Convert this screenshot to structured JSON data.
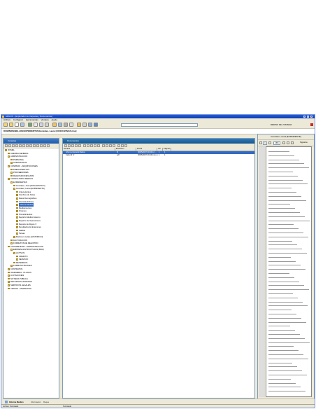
{
  "window": {
    "title": "ARGOS - [Explorador de Carpetas y Documentos]",
    "menu": [
      "Archivo",
      "Configurar",
      "Herramientas",
      "Ventana",
      "Ayuda"
    ]
  },
  "toolbar": {
    "search_value": "",
    "right_label": "MEDINO DEL SISTEMA"
  },
  "pathbar": {
    "text": "DOMINIOS/BELLOS/EXPEDIENTES/Gonzalez, Laura [4001016/05/Informe]"
  },
  "left_panel": {
    "title": "Carpetas",
    "tree": [
      {
        "level": 0,
        "label": "ROMEL"
      },
      {
        "level": 1,
        "label": "AGENDA GENERAL"
      },
      {
        "level": 1,
        "label": "ADMINISTRACION"
      },
      {
        "level": 2,
        "label": "PERSONAL"
      },
      {
        "level": 2,
        "label": "SUMINISTROS"
      },
      {
        "level": 1,
        "label": "COMPRAS - ADQUISICIONES"
      },
      {
        "level": 2,
        "label": "PRESUPUESTOS"
      },
      {
        "level": 2,
        "label": "PROVEEDORES"
      },
      {
        "level": 2,
        "label": "REQUISICIONES 2009"
      },
      {
        "level": 1,
        "label": "CONSULTORIO MEDICO"
      },
      {
        "level": 2,
        "label": "EXPEDIENTES"
      },
      {
        "level": 3,
        "label": "Gonzalez, Juan [DIAGNOSTICO]"
      },
      {
        "level": 3,
        "label": "Gonzalez, Laura [EXPEDIENTE]"
      },
      {
        "level": 4,
        "label": "Antecedentes"
      },
      {
        "level": 4,
        "label": "Cambios de Notas"
      },
      {
        "level": 4,
        "label": "Datos Demograficos"
      },
      {
        "level": 4,
        "label": "Historial [Fichas]"
      },
      {
        "level": 4,
        "label": "Informe Medico",
        "selected": true
      },
      {
        "level": 4,
        "label": "Medicamentos"
      },
      {
        "level": 4,
        "label": "Ordenes"
      },
      {
        "level": 4,
        "label": "Procedimientos"
      },
      {
        "level": 4,
        "label": "Registro Medico Externo"
      },
      {
        "level": 4,
        "label": "Registro de Operaciones"
      },
      {
        "level": 4,
        "label": "Reporte de Rayos X"
      },
      {
        "level": 4,
        "label": "Resultados de Examenes"
      },
      {
        "level": 4,
        "label": "Sabilas"
      },
      {
        "level": 4,
        "label": "Tareas"
      },
      {
        "level": 3,
        "label": "Martinez, Carlos [HISTORICO]"
      },
      {
        "level": 2,
        "label": "FACTURACION"
      },
      {
        "level": 2,
        "label": "FORMATOS DE REGISTRO"
      },
      {
        "level": 1,
        "label": "CONTABILIDAD - ADMINISTRACION"
      },
      {
        "level": 2,
        "label": "EMPRESA ESTRUCTURAS (BLM)"
      },
      {
        "level": 3,
        "label": "ACTIVOS"
      },
      {
        "level": 4,
        "label": "CREDITO"
      },
      {
        "level": 4,
        "label": "SERVICIO"
      },
      {
        "level": 3,
        "label": "RETENIDOS"
      },
      {
        "level": 2,
        "label": "FORMOS FISCALES"
      },
      {
        "level": 1,
        "label": "CONTRATOS"
      },
      {
        "level": 1,
        "label": "INGENIERIA - PLANOS"
      },
      {
        "level": 1,
        "label": "LICITACIONES"
      },
      {
        "level": 1,
        "label": "NOTARIA PUBLICA"
      },
      {
        "level": 1,
        "label": "RECURSOS HUMANOS"
      },
      {
        "level": 1,
        "label": "SERVICIOS LEGALES"
      },
      {
        "level": 1,
        "label": "VENTAS - MARKETING"
      }
    ]
  },
  "center_panel": {
    "title": "Documentos",
    "columns": [
      "Nombre",
      "Extension",
      "Fecha",
      "Ver",
      "Paginas"
    ],
    "rows": [
      {
        "name": "Informe Historial Medico",
        "ext": "tif",
        "date": "06/05/2007 09:33 12 ...",
        "ver": "1",
        "pages": "1",
        "selected": true
      },
      {
        "name": "Falter.tif rrr",
        "ext": "pdf",
        "date": "06/05/2007 09:33 13 p.m.",
        "ver": "1",
        "pages": "1",
        "selected": false
      }
    ]
  },
  "right_panel": {
    "title": "Gonzalez, Laura [EXPEDIENTE]",
    "page_box": "1",
    "zoom_box": "16%",
    "next_label": "Siguiente"
  },
  "bottom_tabs": [
    "Informe Medico",
    "Informacion",
    "Reque"
  ],
  "status_left": "Archivo: Terminado",
  "status_mid": "Terminado"
}
